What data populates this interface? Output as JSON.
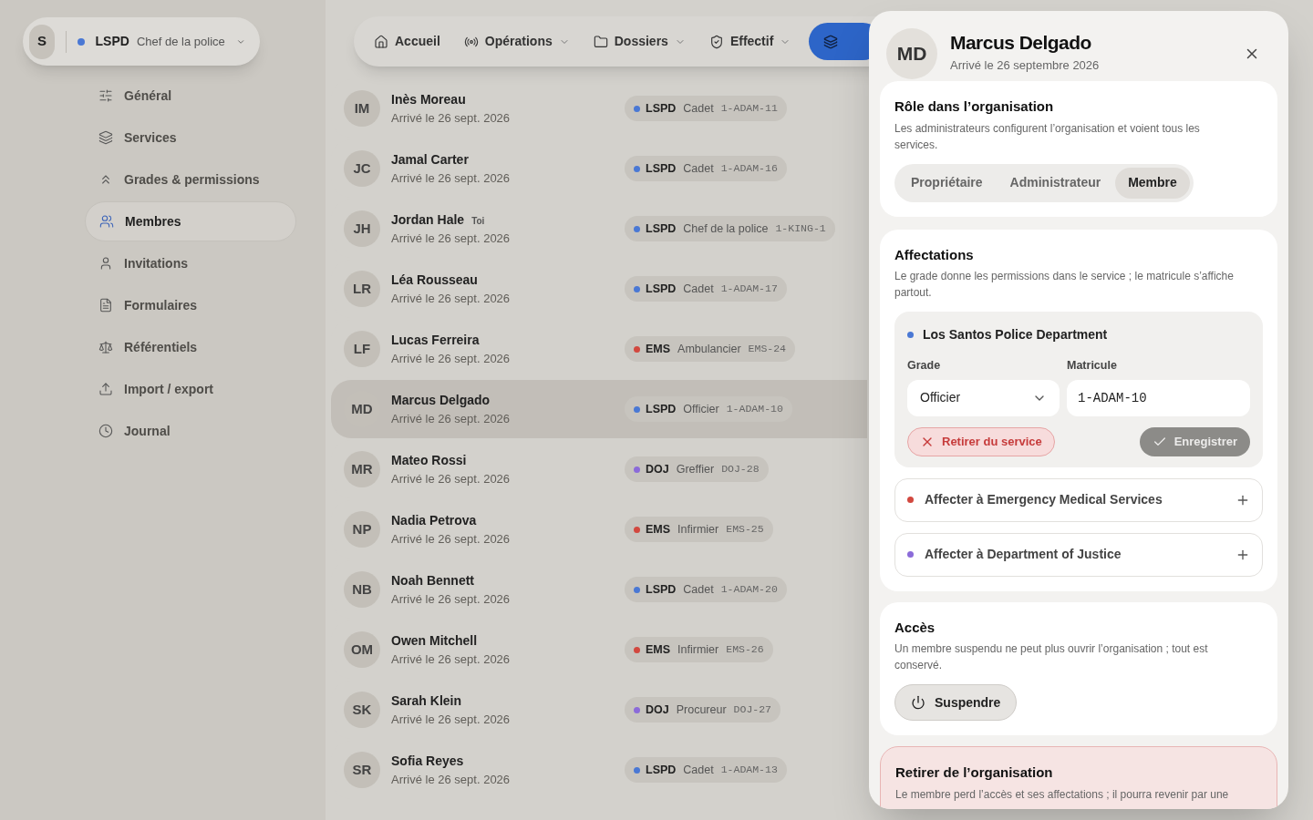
{
  "org_switcher": {
    "avatar": "S",
    "service": "LSPD",
    "color": "#4a78d4",
    "grade": "Chef de la police"
  },
  "sidebar": {
    "items": [
      {
        "label": "Général",
        "selected": false
      },
      {
        "label": "Services",
        "selected": false
      },
      {
        "label": "Grades & permissions",
        "selected": false
      },
      {
        "label": "Membres",
        "selected": true
      },
      {
        "label": "Invitations",
        "selected": false
      },
      {
        "label": "Formulaires",
        "selected": false
      },
      {
        "label": "Référentiels",
        "selected": false
      },
      {
        "label": "Import / export",
        "selected": false
      },
      {
        "label": "Journal",
        "selected": false
      }
    ]
  },
  "topnav": {
    "items": [
      {
        "label": "Accueil",
        "dropdown": false
      },
      {
        "label": "Opérations",
        "dropdown": true
      },
      {
        "label": "Dossiers",
        "dropdown": true
      },
      {
        "label": "Effectif",
        "dropdown": true
      }
    ]
  },
  "members": [
    {
      "initials": "IM",
      "name": "Inès Moreau",
      "arrival": "Arrivé le 26 sept. 2026",
      "selected": false,
      "badge": {
        "service": "LSPD",
        "color": "#4a78d4",
        "grade": "Cadet",
        "callsign": "1-ADAM-11"
      }
    },
    {
      "initials": "JC",
      "name": "Jamal Carter",
      "arrival": "Arrivé le 26 sept. 2026",
      "selected": false,
      "badge": {
        "service": "LSPD",
        "color": "#4a78d4",
        "grade": "Cadet",
        "callsign": "1-ADAM-16"
      }
    },
    {
      "initials": "JH",
      "name": "Jordan Hale",
      "tag": "Toi",
      "arrival": "Arrivé le 26 sept. 2026",
      "selected": false,
      "badge": {
        "service": "LSPD",
        "color": "#4a78d4",
        "grade": "Chef de la police",
        "callsign": "1-KING-1"
      }
    },
    {
      "initials": "LR",
      "name": "Léa Rousseau",
      "arrival": "Arrivé le 26 sept. 2026",
      "selected": false,
      "badge": {
        "service": "LSPD",
        "color": "#4a78d4",
        "grade": "Cadet",
        "callsign": "1-ADAM-17"
      }
    },
    {
      "initials": "LF",
      "name": "Lucas Ferreira",
      "arrival": "Arrivé le 26 sept. 2026",
      "selected": false,
      "badge": {
        "service": "EMS",
        "color": "#d2483f",
        "grade": "Ambulancier",
        "callsign": "EMS-24"
      }
    },
    {
      "initials": "MD",
      "name": "Marcus Delgado",
      "arrival": "Arrivé le 26 sept. 2026",
      "selected": true,
      "badge": {
        "service": "LSPD",
        "color": "#4a78d4",
        "grade": "Officier",
        "callsign": "1-ADAM-10"
      }
    },
    {
      "initials": "MR",
      "name": "Mateo Rossi",
      "arrival": "Arrivé le 26 sept. 2026",
      "selected": false,
      "badge": {
        "service": "DOJ",
        "color": "#8b6bd9",
        "grade": "Greffier",
        "callsign": "DOJ-28"
      }
    },
    {
      "initials": "NP",
      "name": "Nadia Petrova",
      "arrival": "Arrivé le 26 sept. 2026",
      "selected": false,
      "badge": {
        "service": "EMS",
        "color": "#d2483f",
        "grade": "Infirmier",
        "callsign": "EMS-25"
      }
    },
    {
      "initials": "NB",
      "name": "Noah Bennett",
      "arrival": "Arrivé le 26 sept. 2026",
      "selected": false,
      "badge": {
        "service": "LSPD",
        "color": "#4a78d4",
        "grade": "Cadet",
        "callsign": "1-ADAM-20"
      }
    },
    {
      "initials": "OM",
      "name": "Owen Mitchell",
      "arrival": "Arrivé le 26 sept. 2026",
      "selected": false,
      "badge": {
        "service": "EMS",
        "color": "#d2483f",
        "grade": "Infirmier",
        "callsign": "EMS-26"
      }
    },
    {
      "initials": "SK",
      "name": "Sarah Klein",
      "arrival": "Arrivé le 26 sept. 2026",
      "selected": false,
      "badge": {
        "service": "DOJ",
        "color": "#8b6bd9",
        "grade": "Procureur",
        "callsign": "DOJ-27"
      }
    },
    {
      "initials": "SR",
      "name": "Sofia Reyes",
      "arrival": "Arrivé le 26 sept. 2026",
      "selected": false,
      "badge": {
        "service": "LSPD",
        "color": "#4a78d4",
        "grade": "Cadet",
        "callsign": "1-ADAM-13"
      }
    }
  ],
  "panel": {
    "initials": "MD",
    "name": "Marcus Delgado",
    "arrival": "Arrivé le 26 septembre 2026",
    "role": {
      "title": "Rôle dans l’organisation",
      "description": "Les administrateurs configurent l’organisation et voient tous les services.",
      "options": [
        {
          "label": "Propriétaire",
          "selected": false
        },
        {
          "label": "Administrateur",
          "selected": false
        },
        {
          "label": "Membre",
          "selected": true
        }
      ]
    },
    "assignments": {
      "title": "Affectations",
      "description": "Le grade donne les permissions dans le service ; le matricule s’affiche partout.",
      "current": {
        "service": "Los Santos Police Department",
        "color": "#4a78d4",
        "grade_label": "Grade",
        "grade": "Officier",
        "callsign_label": "Matricule",
        "callsign": "1-ADAM-10",
        "remove": "Retirer du service",
        "save": "Enregistrer",
        "save_disabled": true
      },
      "add": [
        {
          "label": "Affecter à Emergency Medical Services",
          "color": "#d2483f"
        },
        {
          "label": "Affecter à Department of Justice",
          "color": "#8b6bd9"
        }
      ]
    },
    "access": {
      "title": "Accès",
      "description": "Un membre suspendu ne peut plus ouvrir l’organisation ; tout est conservé.",
      "button": "Suspendre"
    },
    "danger": {
      "title": "Retirer de l’organisation",
      "description": "Le membre perd l’accès et ses affectations ; il pourra revenir par une"
    }
  }
}
